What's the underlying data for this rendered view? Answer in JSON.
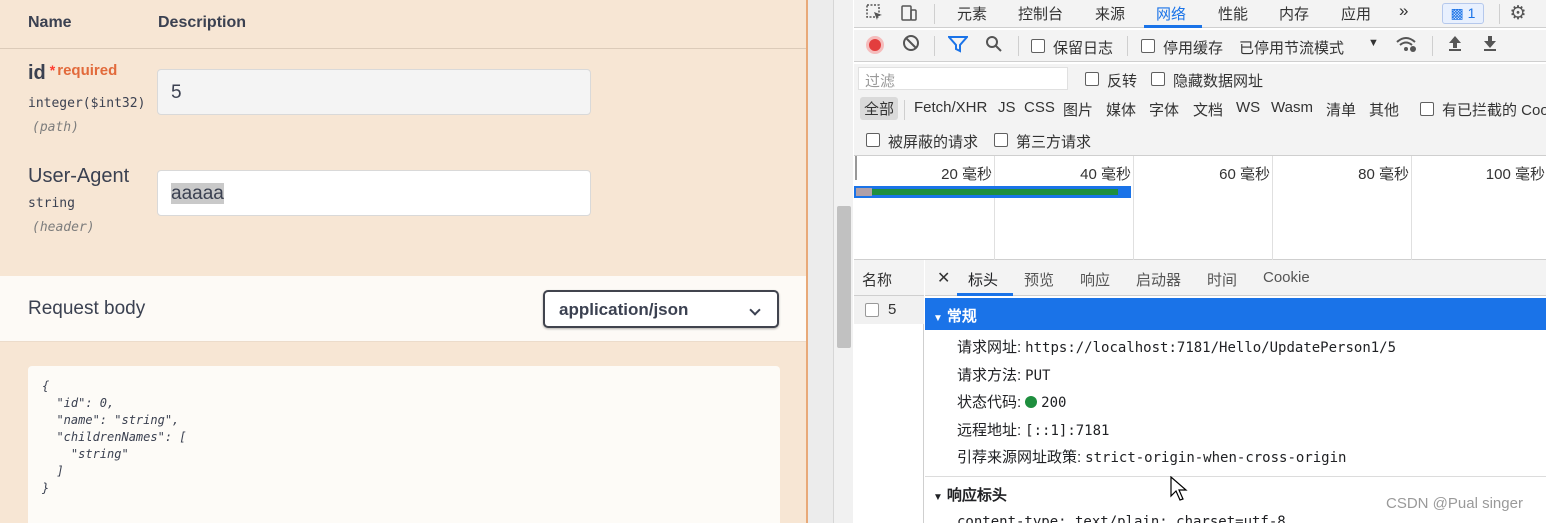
{
  "swagger": {
    "col_name": "Name",
    "col_description": "Description",
    "params": [
      {
        "name": "id",
        "required_star": "*",
        "required_label": "required",
        "type": "integer($int32)",
        "in": "(path)",
        "value": "5"
      },
      {
        "name": "User-Agent",
        "type": "string",
        "in": "(header)",
        "value": "aaaaa"
      }
    ],
    "request_body_title": "Request body",
    "content_type": "application/json",
    "body_example": "{\n  \"id\": 0,\n  \"name\": \"string\",\n  \"childrenNames\": [\n    \"string\"\n  ]\n}"
  },
  "devtools": {
    "main_tabs": [
      "元素",
      "控制台",
      "来源",
      "网络",
      "性能",
      "内存",
      "应用"
    ],
    "active_tab": "网络",
    "more_tabs": "»",
    "message_count": "1",
    "toolbar": {
      "preserve_log": "保留日志",
      "disable_cache": "停用缓存",
      "throttling": "已停用节流模式"
    },
    "filter": {
      "placeholder": "过滤",
      "invert": "反转",
      "hide_data_urls": "隐藏数据网址"
    },
    "types": [
      "全部",
      "Fetch/XHR",
      "JS",
      "CSS",
      "图片",
      "媒体",
      "字体",
      "文档",
      "WS",
      "Wasm",
      "清单",
      "其他"
    ],
    "blocked_cookies": "有已拦截的 Coo",
    "blocked_requests": "被屏蔽的请求",
    "third_party": "第三方请求",
    "timeline_labels": [
      "20 毫秒",
      "40 毫秒",
      "60 毫秒",
      "80 毫秒",
      "100 毫秒"
    ],
    "name_column": "名称",
    "request_name": "5",
    "detail_tabs": [
      "标头",
      "预览",
      "响应",
      "启动器",
      "时间",
      "Cookie"
    ],
    "active_detail_tab": "标头",
    "general": {
      "title": "常规",
      "url_label": "请求网址:",
      "url": "https://localhost:7181/Hello/UpdatePerson1/5",
      "method_label": "请求方法:",
      "method": "PUT",
      "status_label": "状态代码:",
      "status": "200",
      "remote_label": "远程地址:",
      "remote": "[::1]:7181",
      "referrer_label": "引荐来源网址政策:",
      "referrer": "strict-origin-when-cross-origin"
    },
    "response_headers_title": "响应标头",
    "response_header_partial": "content-type: text/plain; charset=utf-8"
  },
  "watermark": "CSDN @Pual singer",
  "colors": {
    "accent": "#1a73e8",
    "status_ok": "#1e8e3e",
    "record": "#e33e3e",
    "required": "#e26a3b"
  }
}
